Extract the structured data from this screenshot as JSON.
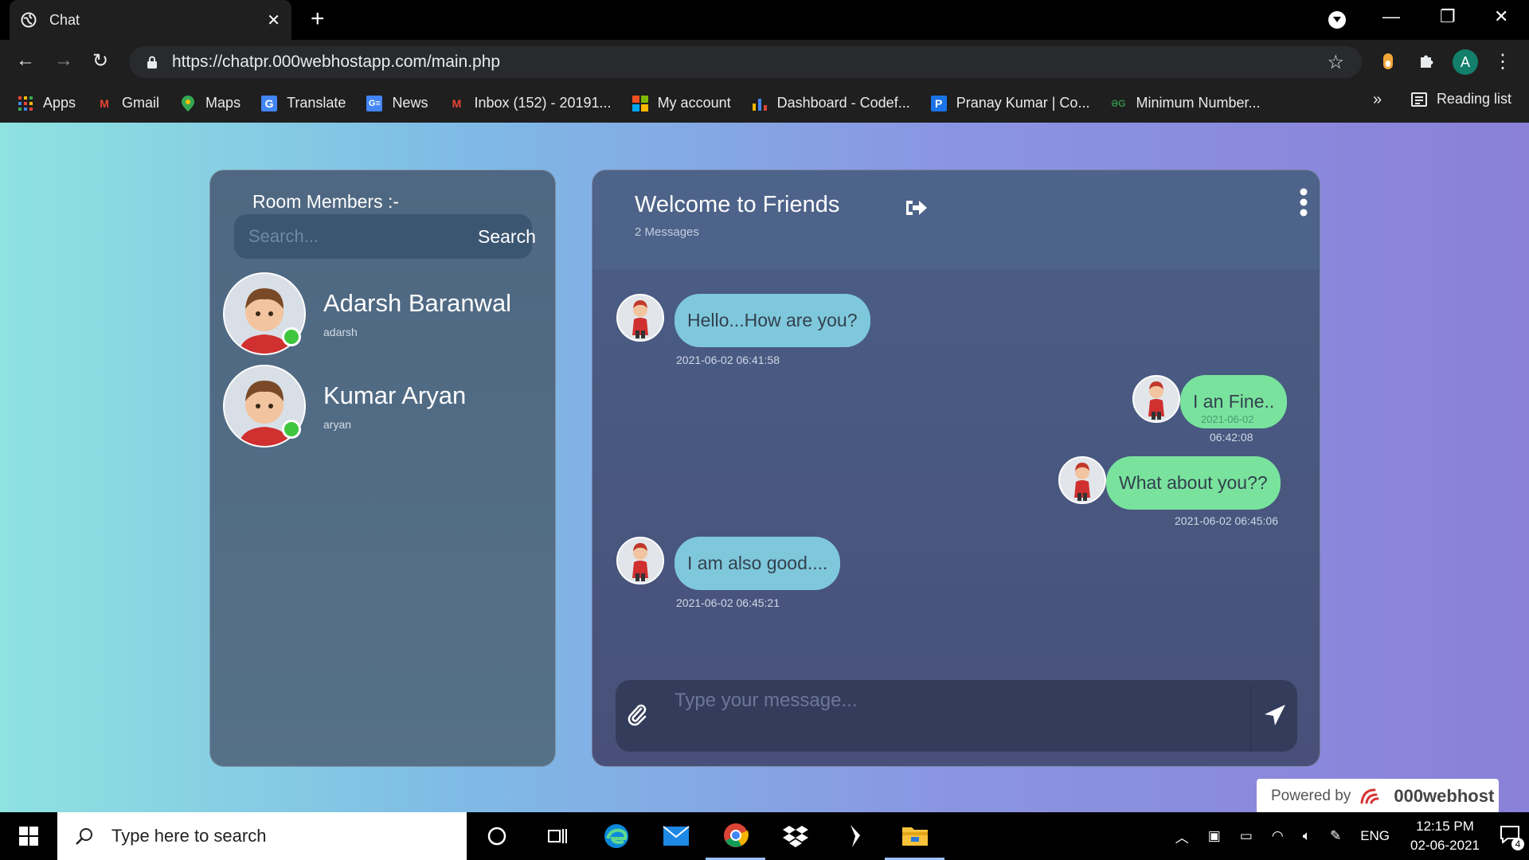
{
  "browser": {
    "tab_title": "Chat",
    "url": "https://chatpr.000webhostapp.com/main.php",
    "profile_initial": "A",
    "bookmarks": [
      {
        "label": "Apps",
        "icon": "apps-grid-icon"
      },
      {
        "label": "Gmail",
        "icon": "gmail-icon"
      },
      {
        "label": "Maps",
        "icon": "maps-pin-icon"
      },
      {
        "label": "Translate",
        "icon": "translate-icon"
      },
      {
        "label": "News",
        "icon": "news-icon"
      },
      {
        "label": "Inbox (152) - 20191...",
        "icon": "gmail-icon"
      },
      {
        "label": "My account",
        "icon": "microsoft-icon"
      },
      {
        "label": "Dashboard - Codef...",
        "icon": "bar-chart-icon"
      },
      {
        "label": "Pranay Kumar | Co...",
        "icon": "p-icon"
      },
      {
        "label": "Minimum Number...",
        "icon": "gfg-icon"
      }
    ],
    "overflow_chevron": "»",
    "reading_list": "Reading list"
  },
  "members": {
    "heading": "Room Members :-",
    "search_placeholder": "Search...",
    "search_button": "Search",
    "list": [
      {
        "name": "Adarsh Baranwal",
        "username": "adarsh"
      },
      {
        "name": "Kumar Aryan",
        "username": "aryan"
      }
    ]
  },
  "chat": {
    "title": "Welcome to Friends",
    "count": "2 Messages",
    "messages": [
      {
        "text": "Hello...How are you?",
        "time": "2021-06-02 06:41:58",
        "dir": "in"
      },
      {
        "text": "I an Fine..",
        "time_line1": "2021-06-02",
        "time_line2": "06:42:08",
        "dir": "out"
      },
      {
        "text": "What about you??",
        "time": "2021-06-02 06:45:06",
        "dir": "out"
      },
      {
        "text": "I am also good....",
        "time": "2021-06-02 06:45:21",
        "dir": "in"
      }
    ],
    "composer_placeholder": "Type your message..."
  },
  "footer": {
    "powered_by": "Powered by",
    "brand": "000webhost"
  },
  "taskbar": {
    "search_placeholder": "Type here to search",
    "language": "ENG",
    "time": "12:15 PM",
    "date": "02-06-2021",
    "notification_count": "4"
  }
}
